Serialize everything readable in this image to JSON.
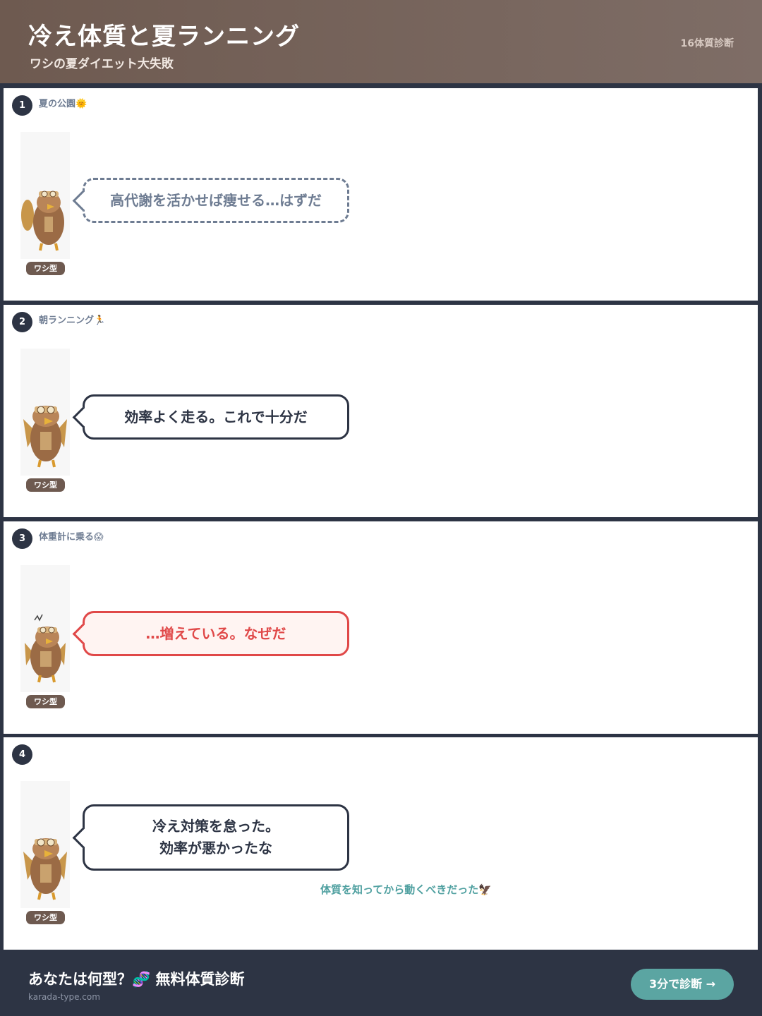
{
  "header": {
    "title": "冷え体質と夏ランニング",
    "subtitle": "ワシの夏ダイエット大失敗",
    "brand": "16体質診断"
  },
  "panels": [
    {
      "number": "1",
      "scene": "夏の公園🌞",
      "character_tag": "ワシ型",
      "bubble_style": "thought",
      "lines": [
        "高代謝を活かせば痩せる…はずだ"
      ]
    },
    {
      "number": "2",
      "scene": "朝ランニング🏃",
      "character_tag": "ワシ型",
      "bubble_style": "speech",
      "lines": [
        "効率よく走る。これで十分だ"
      ]
    },
    {
      "number": "3",
      "scene": "体重計に乗る😱",
      "character_tag": "ワシ型",
      "bubble_style": "alarm",
      "lines": [
        "…増えている。なぜだ"
      ]
    },
    {
      "number": "4",
      "scene": "",
      "character_tag": "ワシ型",
      "bubble_style": "speech",
      "lines": [
        "冷え対策を怠った。",
        "効率が悪かったな"
      ],
      "note": "体質を知ってから動くべきだった🦅"
    }
  ],
  "footer": {
    "cta_text": "あなたは何型？🧬 無料体質診断",
    "domain": "karada-type.com",
    "button_label": "3分で診断 →"
  },
  "colors": {
    "header_brown": "#6e5a50",
    "navy": "#2d3444",
    "alarm_red": "#e04848",
    "teal": "#5ba5a2",
    "muted": "#6e7c92"
  },
  "icons": [
    "eagle-character-icon",
    "dna-icon",
    "sun-emoji",
    "runner-emoji",
    "scream-emoji",
    "eagle-emoji"
  ]
}
